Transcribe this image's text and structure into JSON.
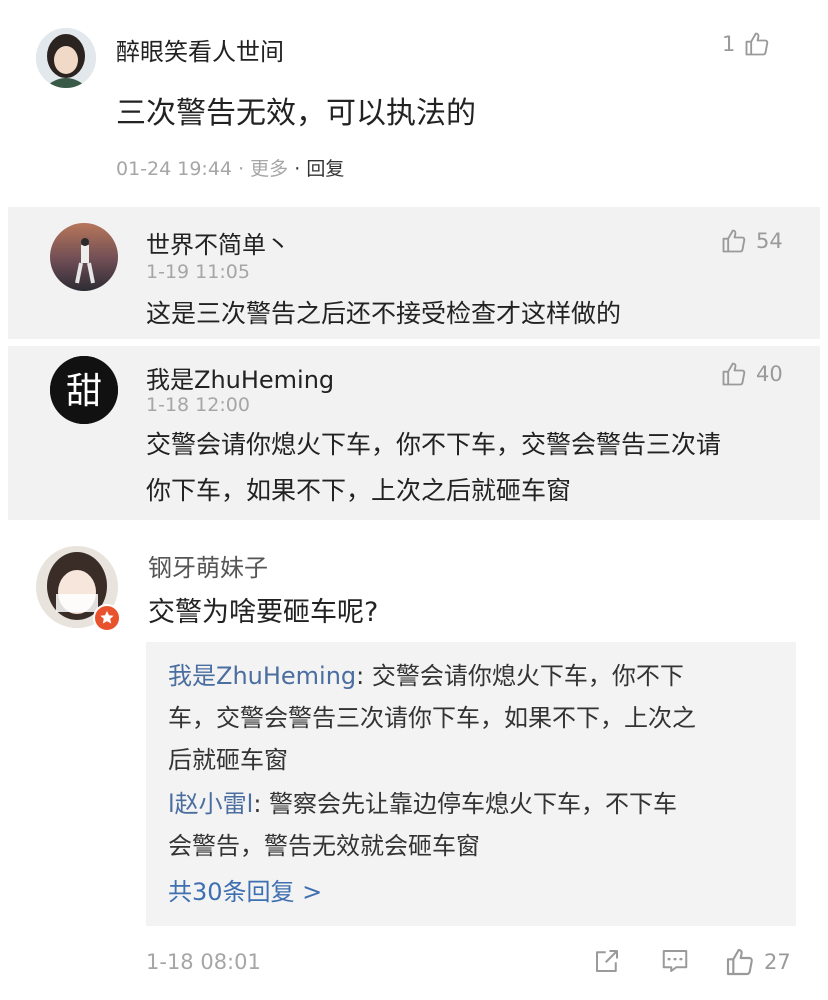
{
  "main_comment": {
    "author": "醉眼笑看人世间",
    "like_count": "1",
    "text": "三次警告无效，可以执法的",
    "time": "01-24 19:44",
    "more": "更多",
    "reply": "回复"
  },
  "replies": [
    {
      "author": "世界不简单丶",
      "time": "1-19 11:05",
      "likes": "54",
      "lines": [
        "这是三次警告之后还不接受检查才这样做的"
      ]
    },
    {
      "author": "我是ZhuHeming",
      "avatar_char": "甜",
      "time": "1-18 12:00",
      "likes": "40",
      "lines": [
        "交警会请你熄火下车，你不下车，交警会警告三次请",
        "你下车，如果不下，上次之后就砸车窗"
      ]
    }
  ],
  "comment3": {
    "author": "钢牙萌妹子",
    "text": "交警为啥要砸车呢?",
    "quote": {
      "reply1_name": "我是ZhuHeming",
      "reply1_line1": ": 交警会请你熄火下车，你不下",
      "reply1_line2": "车，交警会警告三次请你下车，如果不下，上次之",
      "reply1_line3": "后就砸车窗",
      "reply2_name": "l赵小雷l",
      "reply2_line1": ": 警察会先让靠边停车熄火下车，不下车",
      "reply2_line2": "会警告，警告无效就会砸车窗",
      "more_replies": "共30条回复 >"
    },
    "time": "1-18 08:01",
    "likes": "27"
  }
}
